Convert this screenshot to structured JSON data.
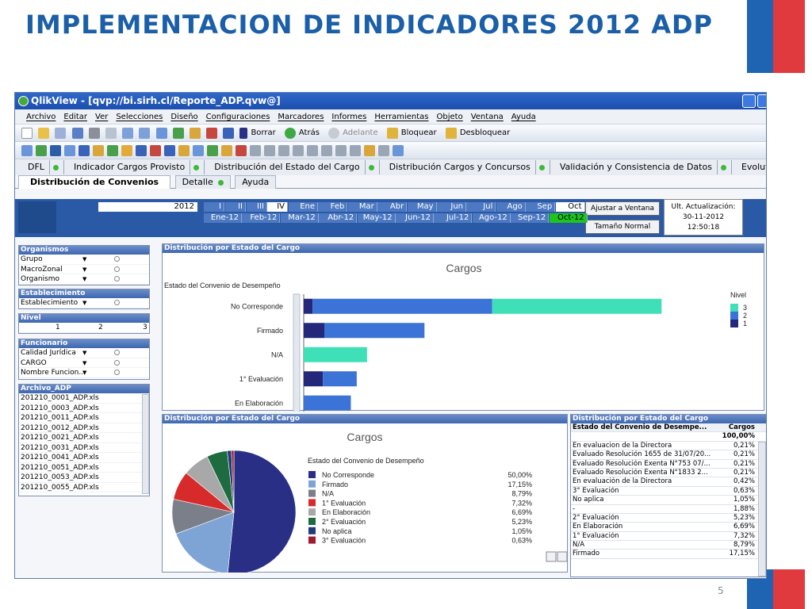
{
  "slide": {
    "title": "IMPLEMENTACION DE INDICADORES 2012 ADP",
    "page_number": "5"
  },
  "window": {
    "title": "QlikView - [qvp://bi.sirh.cl/Reporte_ADP.qvw@]"
  },
  "menu": [
    "Archivo",
    "Editar",
    "Ver",
    "Selecciones",
    "Diseño",
    "Configuraciones",
    "Marcadores",
    "Informes",
    "Herramientas",
    "Objeto",
    "Ventana",
    "Ayuda"
  ],
  "toolbar": {
    "borrar": "Borrar",
    "atras": "Atrás",
    "adelante": "Adelante",
    "bloquear": "Bloquear",
    "desbloquear": "Desbloquear"
  },
  "sheet_tabs": [
    "DFL",
    "Indicador Cargos Provisto",
    "Distribución del Estado del Cargo",
    "Distribución Cargos y Concursos",
    "Validación y Consistencia de Datos",
    "Evolutivo"
  ],
  "sub_tabs": [
    "Distribución de Convenios",
    "Detalle",
    "Ayuda"
  ],
  "filters": {
    "year": "2012",
    "roman": [
      "I",
      "II",
      "III",
      "IV"
    ],
    "months_top": [
      "Ene",
      "Feb",
      "Mar",
      "Abr",
      "May",
      "Jun",
      "Jul",
      "Ago",
      "Sep",
      "Oct"
    ],
    "months_bottom": [
      "Ene-12",
      "Feb-12",
      "Mar-12",
      "Abr-12",
      "May-12",
      "Jun-12",
      "Jul-12",
      "Ago-12",
      "Sep-12",
      "Oct-12"
    ],
    "ajustar": "Ajustar a Ventana",
    "tamano": "Tamaño Normal",
    "update_label": "Ult. Actualización:",
    "update_date": "30-11-2012",
    "update_time": "12:50:18"
  },
  "sidebar": {
    "organismos": {
      "title": "Organismos",
      "rows": [
        "Grupo",
        "MacroZonal",
        "Organismo"
      ]
    },
    "establecimiento": {
      "title": "Establecimiento",
      "rows": [
        "Establecimiento"
      ]
    },
    "nivel": {
      "title": "Nivel",
      "values": [
        "1",
        "2",
        "3"
      ]
    },
    "funcionario": {
      "title": "Funcionario",
      "rows": [
        "Calidad Jurídica",
        "CARGO",
        "Nombre Funcion..."
      ]
    },
    "archivo": {
      "title": "Archivo_ADP",
      "files": [
        "201210_0001_ADP.xls",
        "201210_0003_ADP.xls",
        "201210_0011_ADP.xls",
        "201210_0012_ADP.xls",
        "201210_0021_ADP.xls",
        "201210_0031_ADP.xls",
        "201210_0041_ADP.xls",
        "201210_0051_ADP.xls",
        "201210_0053_ADP.xls",
        "201210_0055_ADP.xls"
      ]
    }
  },
  "bar_panel": {
    "header": "Distribución por Estado del Cargo",
    "title": "Cargos",
    "dim_label": "Estado del Convenio de Desempeño",
    "legend_title": "Nivel"
  },
  "pie_panel": {
    "header": "Distribución por Estado del Cargo",
    "title": "Cargos",
    "legend_title": "Estado del Convenio de Desempeño"
  },
  "table_panel": {
    "header": "Distribución por Estado del Cargo",
    "col1": "Estado del Convenio de Desempe...",
    "col2": "Cargos",
    "total": "100,00%",
    "rows": [
      {
        "label": "En evaluacion de la Directora",
        "value": "0,21%"
      },
      {
        "label": "Evaluado Resolución 1655 de 31/07/20...",
        "value": "0,21%"
      },
      {
        "label": "Evaluado Resolución Exenta N°753 07/...",
        "value": "0,21%"
      },
      {
        "label": "Evaluado Resolución Exenta N°1833 2...",
        "value": "0,21%"
      },
      {
        "label": "En evaluación de la Directora",
        "value": "0,42%"
      },
      {
        "label": "3° Evaluación",
        "value": "0,63%"
      },
      {
        "label": "No aplica",
        "value": "1,05%"
      },
      {
        "label": "-",
        "value": "1,88%"
      },
      {
        "label": "2° Evaluación",
        "value": "5,23%"
      },
      {
        "label": "En Elaboración",
        "value": "6,69%"
      },
      {
        "label": "1° Evaluación",
        "value": "7,32%"
      },
      {
        "label": "N/A",
        "value": "8,79%"
      },
      {
        "label": "Firmado",
        "value": "17,15%"
      }
    ]
  },
  "colors": {
    "n1": "#23287a",
    "n2": "#3b73d6",
    "n3": "#3fe0b8"
  },
  "chart_data": [
    {
      "type": "bar",
      "title": "Cargos",
      "xlabel": "",
      "ylabel": "Estado del Convenio de Desempeño",
      "categories": [
        "No Corresponde",
        "Firmado",
        "N/A",
        "1° Evaluación",
        "En Elaboración"
      ],
      "series": [
        {
          "name": "1",
          "values": [
            6,
            14,
            0,
            13,
            0
          ]
        },
        {
          "name": "2",
          "values": [
            122,
            68,
            0,
            23,
            32
          ]
        },
        {
          "name": "3",
          "values": [
            115,
            0,
            43,
            0,
            0
          ]
        }
      ],
      "xlim": [
        0,
        280
      ],
      "xticks": [
        "0",
        "20",
        "40",
        "60",
        "80",
        "100",
        "120",
        "140",
        "160",
        "180",
        "200",
        "220",
        "240",
        "260",
        "280"
      ],
      "legend": "right"
    },
    {
      "type": "pie",
      "title": "Cargos",
      "categories": [
        "No Corresponde",
        "Firmado",
        "N/A",
        "1° Evaluación",
        "En Elaboración",
        "2° Evaluación",
        "No aplica",
        "3° Evaluación"
      ],
      "values": [
        50.0,
        17.15,
        8.79,
        7.32,
        6.69,
        5.23,
        1.05,
        0.63
      ],
      "labels": [
        "50,00%",
        "17,15%",
        "8,79%",
        "7,32%",
        "6,69%",
        "5,23%",
        "1,05%",
        "0,63%"
      ],
      "colors": [
        "#2a2f86",
        "#7ea4d6",
        "#7a7f8a",
        "#d72a2a",
        "#a8a8a8",
        "#1d6b3e",
        "#1f3b7a",
        "#9c1b30"
      ],
      "legend": "right"
    }
  ]
}
